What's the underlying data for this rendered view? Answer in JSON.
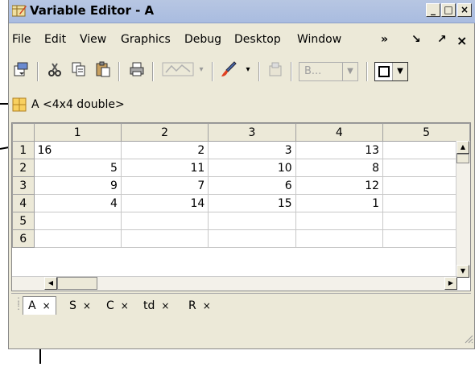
{
  "window": {
    "title": "Variable Editor - A",
    "buttons": [
      "_",
      "□",
      "×"
    ]
  },
  "menu": {
    "items": [
      "File",
      "Edit",
      "View",
      "Graphics",
      "Debug",
      "Desktop",
      "Window"
    ],
    "overflow": "»",
    "undock": "↘",
    "pin": "↗",
    "close": "×"
  },
  "toolbar": {
    "base_dropdown": "B..."
  },
  "variable": {
    "label": "A <4x4 double>"
  },
  "grid": {
    "columns": [
      "1",
      "2",
      "3",
      "4",
      "5"
    ],
    "selected_column": "1",
    "rows": [
      {
        "header": "1",
        "cells": [
          "16",
          "2",
          "3",
          "13",
          ""
        ]
      },
      {
        "header": "2",
        "cells": [
          "5",
          "11",
          "10",
          "8",
          ""
        ]
      },
      {
        "header": "3",
        "cells": [
          "9",
          "7",
          "6",
          "12",
          ""
        ]
      },
      {
        "header": "4",
        "cells": [
          "4",
          "14",
          "15",
          "1",
          ""
        ]
      },
      {
        "header": "5",
        "cells": [
          "",
          "",
          "",
          "",
          ""
        ]
      },
      {
        "header": "6",
        "cells": [
          "",
          "",
          "",
          "",
          ""
        ]
      }
    ]
  },
  "tabs": [
    {
      "label": "A",
      "close": "×"
    },
    {
      "label": "S",
      "close": "×"
    },
    {
      "label": "C",
      "close": "×"
    },
    {
      "label": "td",
      "close": "×"
    },
    {
      "label": "R",
      "close": "×"
    }
  ]
}
